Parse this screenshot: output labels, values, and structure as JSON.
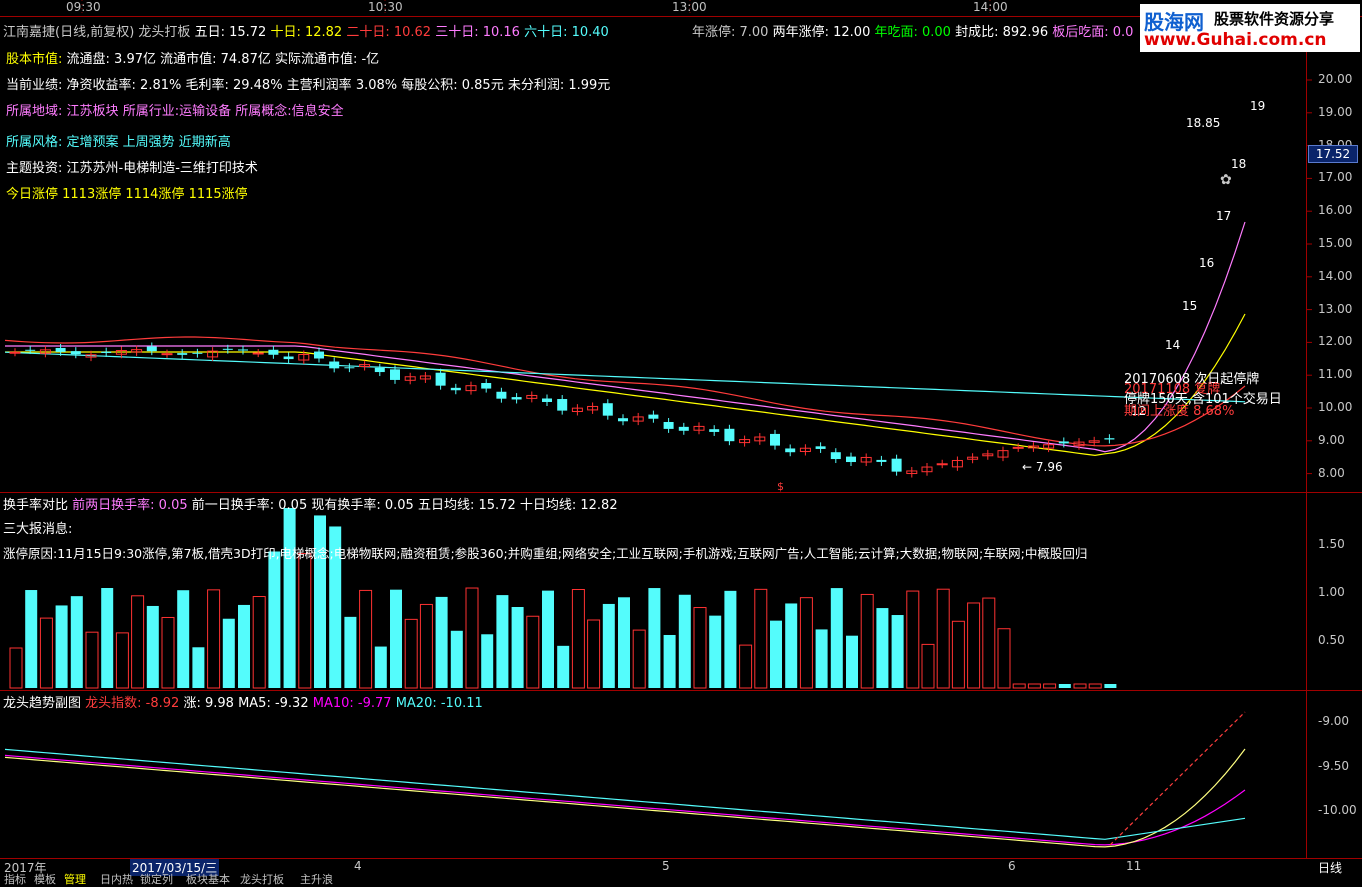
{
  "time_axis": [
    "09:30",
    "10:30",
    "13:00",
    "14:00"
  ],
  "header": {
    "stock_name": "江南嘉捷(日线,前复权)",
    "indicator": "龙头打板",
    "ma5": "五日: 15.72",
    "ma10": "十日: 12.82",
    "ma20": "二十日: 10.62",
    "ma30": "三十日: 10.16",
    "ma60": "六十日: 10.40",
    "year_limit": "年涨停: 7.00",
    "two_year_limit": "两年涨停: 12.00",
    "year_eat": "年吃面: 0.00",
    "seal_ratio": "封成比: 892.96",
    "after_board": "板后吃面: 0.0"
  },
  "info_lines": {
    "share_label": "股本市值:",
    "share_value": "流通盘: 3.97亿 流通市值: 74.87亿  实际流通市值: -亿",
    "perf_label": "当前业绩:",
    "perf_value": "净资收益率: 2.81% 毛利率: 29.48% 主营利润率 3.08% 每股公积: 0.85元 未分利润: 1.99元",
    "region_label": "所属地域:",
    "region_value": "江苏板块",
    "industry_label": "所属行业:",
    "industry_value": "运输设备",
    "concept_label": "所属概念:",
    "concept_value": "信息安全",
    "style_label": "所属风格:",
    "style_value": "定增预案 上周强势 近期新高",
    "theme_label": "主题投资:",
    "theme_value": "江苏苏州-电梯制造-三维打印技术",
    "limit_today": "今日涨停 1113涨停 1114涨停 1115涨停"
  },
  "price_axis": [
    "20.00",
    "19.00",
    "18.00",
    "17.00",
    "16.00",
    "15.00",
    "14.00",
    "13.00",
    "12.00",
    "11.00",
    "10.00",
    "9.00",
    "8.00"
  ],
  "current_price": "17.52",
  "price_annotations": {
    "p1885": "18.85",
    "p19": "19",
    "p18": "18",
    "p17": "17",
    "p16": "16",
    "p15": "15",
    "p14": "14",
    "p12": "12",
    "low": "7.96",
    "note1": "20170608 次日起停牌",
    "note2": "20171108 复牌",
    "note3": "停牌150天,含101个交易日",
    "note4": "期间上涨度 8.68%",
    "marker_s": "$"
  },
  "turnover": {
    "title": "换手率对比",
    "prev2_label": "前两日换手率: 0.05",
    "prev1_label": "前一日换手率: 0.05",
    "current_label": "现有换手率: 0.05",
    "ma5_label": "五日均线: 15.72",
    "ma10_label": "十日均线: 12.82",
    "news": "三大报消息:",
    "reason": "涨停原因:11月15日9:30涨停,第7板,借壳3D打印,电梯概念;电梯物联网;融资租赁;参股360;并购重组;网络安全;工业互联网;手机游戏;互联网广告;人工智能;云计算;大数据;物联网;车联网;中概股回归",
    "axis": [
      "1.50",
      "1.00",
      "0.50"
    ]
  },
  "trend": {
    "title": "龙头趋势副图",
    "index_label": "龙头指数: -8.92",
    "rise_label": "涨: 9.98",
    "ma5_label": "MA5: -9.32",
    "ma10_label": "MA10: -9.77",
    "ma20_label": "MA20: -10.11",
    "axis": [
      "-9.00",
      "-9.50",
      "-10.00"
    ]
  },
  "bottom_axis": {
    "year": "2017年",
    "date": "2017/03/15/三",
    "m4": "4",
    "m5": "5",
    "m6": "6",
    "m11": "11",
    "period": "日线"
  },
  "tabs": [
    "指标",
    "模板",
    "管理",
    "日内热",
    "锁定列",
    "板块基本",
    "龙头打板",
    "主升浪"
  ],
  "logo": {
    "brand": "股海网",
    "slogan": "股票软件资源分享",
    "url": "www.Guhai.com.cn"
  },
  "colors": {
    "up": "#ff3232",
    "down": "#54fcfc",
    "ma5": "#ffffff",
    "ma10": "#ffff00",
    "ma20": "#ff00ff",
    "ma60": "#00ff00"
  }
}
